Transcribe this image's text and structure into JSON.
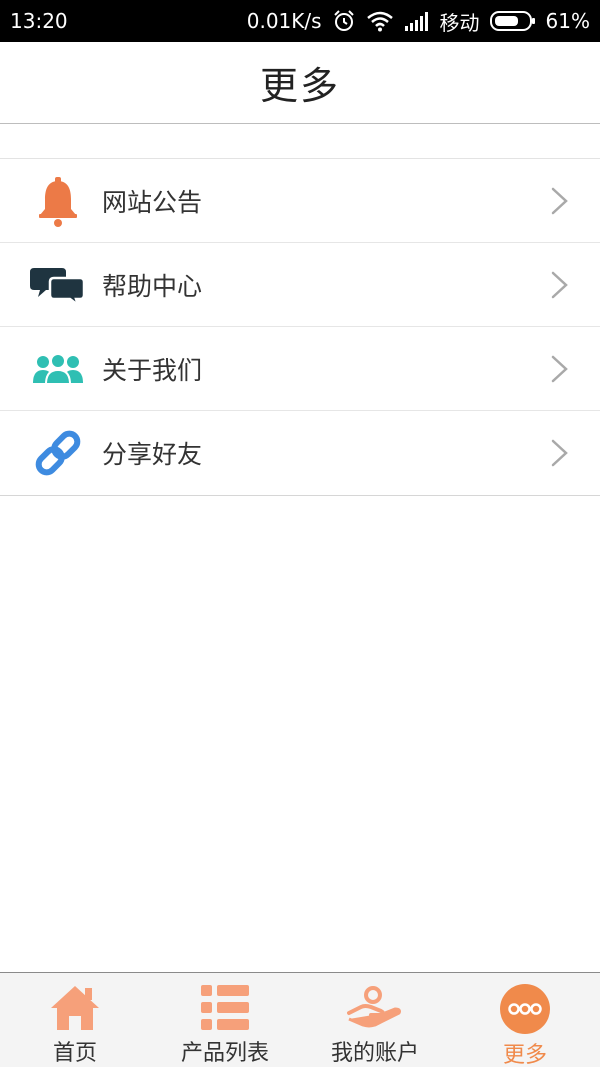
{
  "status_bar": {
    "time": "13:20",
    "network_speed": "0.01K/s",
    "carrier": "移动",
    "battery": "61%",
    "icons": [
      "alarm-icon",
      "wifi-icon",
      "signal-icon",
      "battery-icon"
    ]
  },
  "header": {
    "title": "更多"
  },
  "menu": {
    "items": [
      {
        "label": "网站公告",
        "icon": "bell-icon",
        "color": "#ec7a47"
      },
      {
        "label": "帮助中心",
        "icon": "chat-bubbles-icon",
        "color": "#1f3440"
      },
      {
        "label": "关于我们",
        "icon": "users-icon",
        "color": "#2fbfb3"
      },
      {
        "label": "分享好友",
        "icon": "link-icon",
        "color": "#3e8be0"
      }
    ]
  },
  "tab_bar": {
    "tabs": [
      {
        "label": "首页",
        "icon": "home-icon",
        "active": false
      },
      {
        "label": "产品列表",
        "icon": "list-icon",
        "active": false
      },
      {
        "label": "我的账户",
        "icon": "hand-coin-icon",
        "active": false
      },
      {
        "label": "更多",
        "icon": "more-icon",
        "active": true
      }
    ],
    "icon_color": "#f6a07a",
    "active_color": "#f08a4b"
  }
}
